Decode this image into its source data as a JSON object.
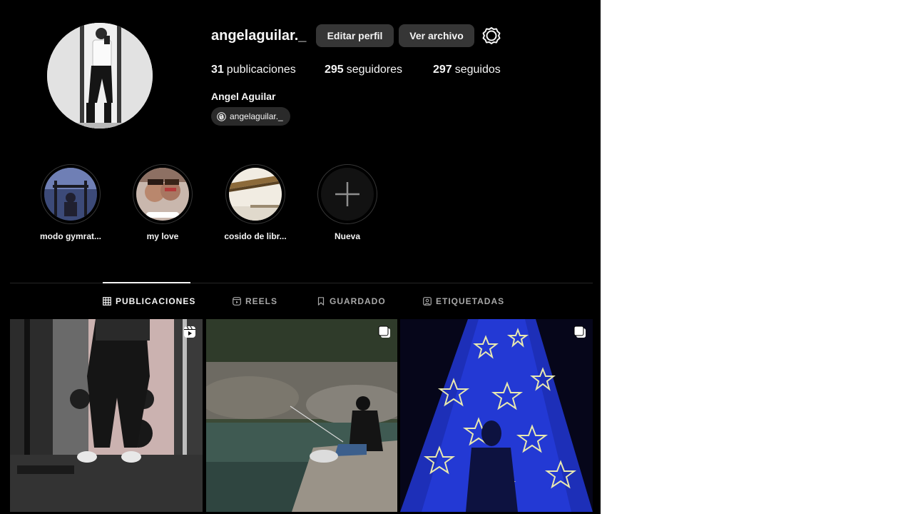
{
  "profile": {
    "username": "angelaguilar._",
    "edit_button": "Editar perfil",
    "archive_button": "Ver archivo",
    "stats": {
      "posts_count": "31",
      "posts_label": "publicaciones",
      "followers_count": "295",
      "followers_label": "seguidores",
      "following_count": "297",
      "following_label": "seguidos"
    },
    "full_name": "Angel Aguilar",
    "threads_handle": "angelaguilar._"
  },
  "highlights": [
    {
      "label": "modo gymrat..."
    },
    {
      "label": "my love"
    },
    {
      "label": "cosido de libr..."
    },
    {
      "label": "Nueva"
    }
  ],
  "tabs": [
    {
      "label": "PUBLICACIONES",
      "active": true,
      "icon": "grid-icon"
    },
    {
      "label": "REELS",
      "active": false,
      "icon": "reels-icon"
    },
    {
      "label": "GUARDADO",
      "active": false,
      "icon": "bookmark-icon"
    },
    {
      "label": "ETIQUETADAS",
      "active": false,
      "icon": "tagged-icon"
    }
  ],
  "posts": [
    {
      "type": "reel",
      "badge_icon": "reel-icon"
    },
    {
      "type": "carousel",
      "badge_icon": "carousel-icon"
    },
    {
      "type": "carousel",
      "badge_icon": "carousel-icon"
    }
  ],
  "colors": {
    "background": "#000000",
    "button": "#363636",
    "text": "#f5f5f5",
    "muted": "#a8a8a8"
  }
}
